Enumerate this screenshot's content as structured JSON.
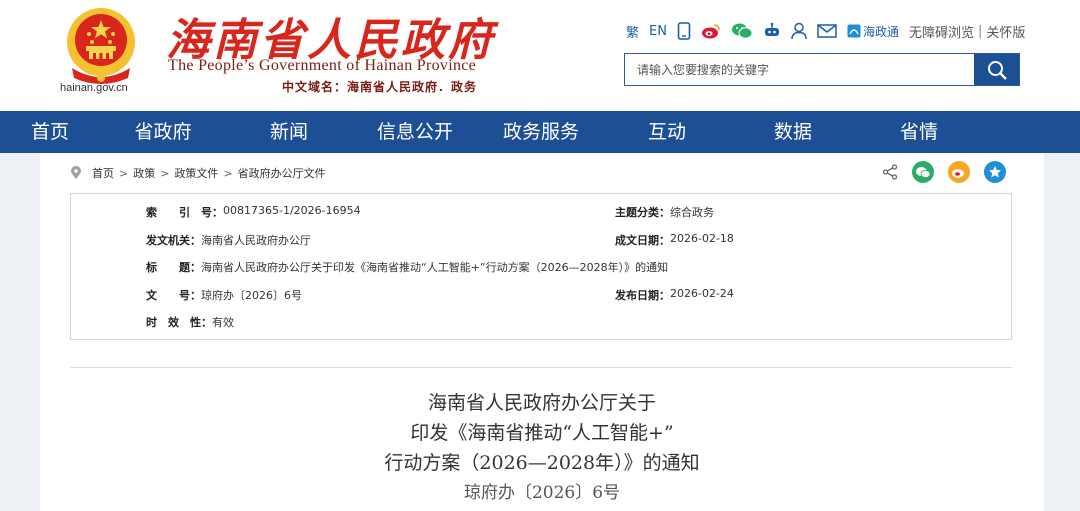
{
  "header": {
    "title": "海南省人民政府",
    "subtitle": "The People’s Government of Hainan Province",
    "domain_cn": "中文域名：海南省人民政府．政务",
    "domain": "hainan.gov.cn",
    "brand_red": "#d9261c",
    "brand_blue": "#1d4f95"
  },
  "toolbar": {
    "traditional": "繁",
    "english": "EN",
    "icons": [
      "mobile-icon",
      "weibo-icon",
      "wechat-icon",
      "robot-icon",
      "user-icon",
      "mail-icon"
    ],
    "app_name": "海政通",
    "accessibility": "无障碍浏览",
    "separator": "|",
    "elderly": "关怀版"
  },
  "search": {
    "placeholder": "请输入您要搜索的关键字"
  },
  "nav": {
    "items": [
      "首页",
      "省政府",
      "新闻",
      "信息公开",
      "政务服务",
      "互动",
      "数据",
      "省情"
    ]
  },
  "breadcrumb": {
    "items": [
      "首页",
      "政策",
      "政策文件",
      "省政府办公厅文件"
    ],
    "separator": ">"
  },
  "meta": {
    "index_label": "索　　引　号：",
    "index_value": "00817365-1/2026-16954",
    "topic_label": "主题分类：",
    "topic_value": "综合政务",
    "issuer_label": "发文机关：",
    "issuer_value": "海南省人民政府办公厅",
    "created_label": "成文日期：",
    "created_value": "2026-02-18",
    "subject_label": "标　　题：",
    "subject_value": "海南省人民政府办公厅关于印发《海南省推动“人工智能+”行动方案（2026—2028年）》的通知",
    "docno_label": "文　　号：",
    "docno_value": "琼府办〔2026〕6号",
    "published_label": "发布日期：",
    "published_value": "2026-02-24",
    "validity_label": "时　效　性：",
    "validity_value": "有效"
  },
  "document": {
    "title_line1": "海南省人民政府办公厅关于",
    "title_line2": "印发《海南省推动“人工智能+”",
    "title_line3": "行动方案（2026—2028年）》的通知",
    "number": "琼府办〔2026〕6号"
  }
}
